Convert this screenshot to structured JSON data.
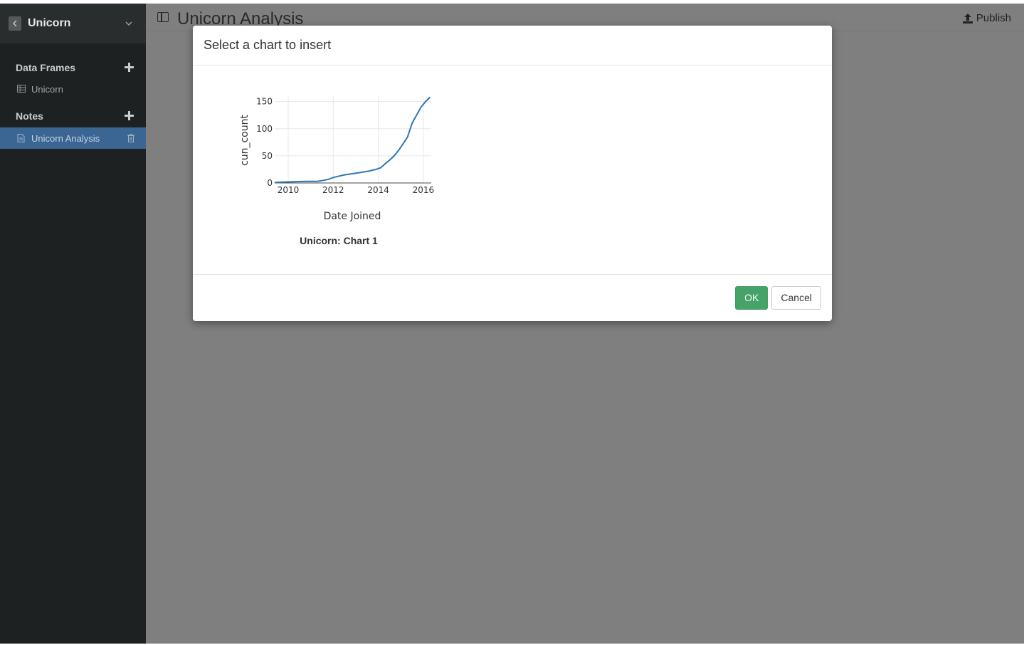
{
  "sidebar": {
    "title": "Unicorn",
    "sections": {
      "data_frames": {
        "label": "Data Frames",
        "items": [
          {
            "label": "Unicorn"
          }
        ]
      },
      "notes": {
        "label": "Notes",
        "items": [
          {
            "label": "Unicorn Analysis"
          }
        ]
      }
    }
  },
  "main": {
    "note_title": "Unicorn Analysis",
    "publish_label": "Publish"
  },
  "modal": {
    "title": "Select a chart to insert",
    "ok_label": "OK",
    "cancel_label": "Cancel",
    "charts": [
      {
        "caption": "Unicorn: Chart 1"
      }
    ]
  },
  "colors": {
    "sidebar_bg": "#1e2121",
    "active_item": "#3b6694",
    "ok_button": "#46a367",
    "line": "#2f76b3"
  },
  "icons": {
    "back": "chevron-left-icon",
    "collapse": "chevron-down-icon",
    "add": "plus-icon",
    "data_frame": "table-icon",
    "note": "document-icon",
    "delete": "trash-icon",
    "panel": "sidebar-toggle-icon",
    "publish": "upload-icon"
  },
  "chart_data": {
    "type": "line",
    "title": "",
    "xlabel": "Date Joined",
    "ylabel": "cun_count",
    "xlim": [
      2009.4,
      2016.35
    ],
    "ylim": [
      0,
      160
    ],
    "xticks": [
      "2010",
      "2012",
      "2014",
      "2016"
    ],
    "yticks": [
      "0",
      "50",
      "100",
      "150"
    ],
    "grid": true,
    "series": [
      {
        "values_x": [
          2009.4,
          2010.0,
          2010.8,
          2011.3,
          2011.6,
          2011.8,
          2012.0,
          2012.2,
          2012.5,
          2013.0,
          2013.3,
          2013.6,
          2013.9,
          2014.1,
          2014.3,
          2014.5,
          2014.7,
          2014.9,
          2015.1,
          2015.3,
          2015.5,
          2015.7,
          2015.9,
          2016.1,
          2016.3
        ],
        "values_y": [
          1,
          2,
          3,
          3,
          5,
          7,
          10,
          12,
          15,
          18,
          20,
          22,
          25,
          28,
          35,
          42,
          50,
          60,
          72,
          85,
          110,
          125,
          140,
          150,
          158
        ]
      }
    ]
  }
}
